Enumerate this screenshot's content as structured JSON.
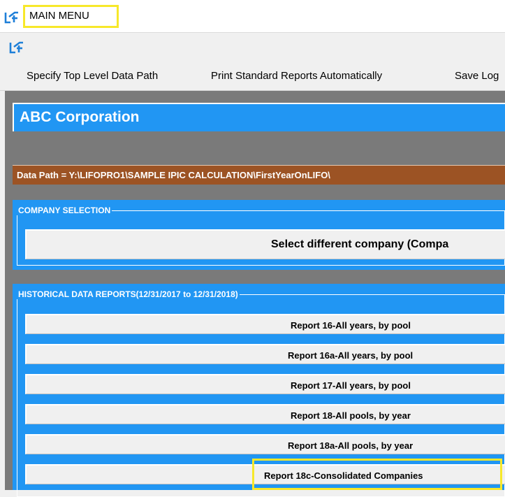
{
  "window": {
    "title": "MAIN MENU"
  },
  "menu": {
    "items": [
      {
        "label": "Specify Top Level Data Path"
      },
      {
        "label": "Print Standard Reports Automatically"
      },
      {
        "label": "Save Log"
      }
    ]
  },
  "company": {
    "name": "ABC Corporation"
  },
  "data_path": {
    "text": "Data Path = Y:\\LIFOPRO1\\SAMPLE IPIC CALCULATION\\FirstYearOnLIFO\\"
  },
  "company_selection": {
    "title": "COMPANY SELECTION",
    "button_label": "Select different company (Compa"
  },
  "historical": {
    "title": "HISTORICAL DATA REPORTS(12/31/2017 to 12/31/2018)",
    "reports": [
      {
        "label": "Report 16-All years, by pool"
      },
      {
        "label": "Report 16a-All years, by pool"
      },
      {
        "label": "Report 17-All years, by pool"
      },
      {
        "label": "Report 18-All pools, by year"
      },
      {
        "label": "Report 18a-All pools, by year"
      },
      {
        "label": "Report 18c-Consolidated Companies"
      }
    ]
  },
  "colors": {
    "accent_blue": "#2196f3",
    "path_brown": "#9c5324",
    "highlight_yellow": "#f7e82a",
    "frame_gray": "#7a7a7a"
  },
  "icons": {
    "app_icon": "lifopro-logo-icon"
  }
}
